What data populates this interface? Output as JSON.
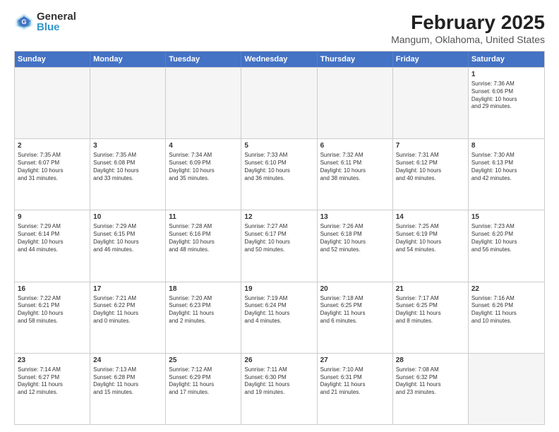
{
  "logo": {
    "general": "General",
    "blue": "Blue"
  },
  "title": "February 2025",
  "subtitle": "Mangum, Oklahoma, United States",
  "header": {
    "days": [
      "Sunday",
      "Monday",
      "Tuesday",
      "Wednesday",
      "Thursday",
      "Friday",
      "Saturday"
    ]
  },
  "rows": [
    [
      {
        "day": "",
        "empty": true
      },
      {
        "day": "",
        "empty": true
      },
      {
        "day": "",
        "empty": true
      },
      {
        "day": "",
        "empty": true
      },
      {
        "day": "",
        "empty": true
      },
      {
        "day": "",
        "empty": true
      },
      {
        "day": "1",
        "info": "Sunrise: 7:36 AM\nSunset: 6:06 PM\nDaylight: 10 hours\nand 29 minutes."
      }
    ],
    [
      {
        "day": "2",
        "info": "Sunrise: 7:35 AM\nSunset: 6:07 PM\nDaylight: 10 hours\nand 31 minutes."
      },
      {
        "day": "3",
        "info": "Sunrise: 7:35 AM\nSunset: 6:08 PM\nDaylight: 10 hours\nand 33 minutes."
      },
      {
        "day": "4",
        "info": "Sunrise: 7:34 AM\nSunset: 6:09 PM\nDaylight: 10 hours\nand 35 minutes."
      },
      {
        "day": "5",
        "info": "Sunrise: 7:33 AM\nSunset: 6:10 PM\nDaylight: 10 hours\nand 36 minutes."
      },
      {
        "day": "6",
        "info": "Sunrise: 7:32 AM\nSunset: 6:11 PM\nDaylight: 10 hours\nand 38 minutes."
      },
      {
        "day": "7",
        "info": "Sunrise: 7:31 AM\nSunset: 6:12 PM\nDaylight: 10 hours\nand 40 minutes."
      },
      {
        "day": "8",
        "info": "Sunrise: 7:30 AM\nSunset: 6:13 PM\nDaylight: 10 hours\nand 42 minutes."
      }
    ],
    [
      {
        "day": "9",
        "info": "Sunrise: 7:29 AM\nSunset: 6:14 PM\nDaylight: 10 hours\nand 44 minutes."
      },
      {
        "day": "10",
        "info": "Sunrise: 7:29 AM\nSunset: 6:15 PM\nDaylight: 10 hours\nand 46 minutes."
      },
      {
        "day": "11",
        "info": "Sunrise: 7:28 AM\nSunset: 6:16 PM\nDaylight: 10 hours\nand 48 minutes."
      },
      {
        "day": "12",
        "info": "Sunrise: 7:27 AM\nSunset: 6:17 PM\nDaylight: 10 hours\nand 50 minutes."
      },
      {
        "day": "13",
        "info": "Sunrise: 7:26 AM\nSunset: 6:18 PM\nDaylight: 10 hours\nand 52 minutes."
      },
      {
        "day": "14",
        "info": "Sunrise: 7:25 AM\nSunset: 6:19 PM\nDaylight: 10 hours\nand 54 minutes."
      },
      {
        "day": "15",
        "info": "Sunrise: 7:23 AM\nSunset: 6:20 PM\nDaylight: 10 hours\nand 56 minutes."
      }
    ],
    [
      {
        "day": "16",
        "info": "Sunrise: 7:22 AM\nSunset: 6:21 PM\nDaylight: 10 hours\nand 58 minutes."
      },
      {
        "day": "17",
        "info": "Sunrise: 7:21 AM\nSunset: 6:22 PM\nDaylight: 11 hours\nand 0 minutes."
      },
      {
        "day": "18",
        "info": "Sunrise: 7:20 AM\nSunset: 6:23 PM\nDaylight: 11 hours\nand 2 minutes."
      },
      {
        "day": "19",
        "info": "Sunrise: 7:19 AM\nSunset: 6:24 PM\nDaylight: 11 hours\nand 4 minutes."
      },
      {
        "day": "20",
        "info": "Sunrise: 7:18 AM\nSunset: 6:25 PM\nDaylight: 11 hours\nand 6 minutes."
      },
      {
        "day": "21",
        "info": "Sunrise: 7:17 AM\nSunset: 6:25 PM\nDaylight: 11 hours\nand 8 minutes."
      },
      {
        "day": "22",
        "info": "Sunrise: 7:16 AM\nSunset: 6:26 PM\nDaylight: 11 hours\nand 10 minutes."
      }
    ],
    [
      {
        "day": "23",
        "info": "Sunrise: 7:14 AM\nSunset: 6:27 PM\nDaylight: 11 hours\nand 12 minutes."
      },
      {
        "day": "24",
        "info": "Sunrise: 7:13 AM\nSunset: 6:28 PM\nDaylight: 11 hours\nand 15 minutes."
      },
      {
        "day": "25",
        "info": "Sunrise: 7:12 AM\nSunset: 6:29 PM\nDaylight: 11 hours\nand 17 minutes."
      },
      {
        "day": "26",
        "info": "Sunrise: 7:11 AM\nSunset: 6:30 PM\nDaylight: 11 hours\nand 19 minutes."
      },
      {
        "day": "27",
        "info": "Sunrise: 7:10 AM\nSunset: 6:31 PM\nDaylight: 11 hours\nand 21 minutes."
      },
      {
        "day": "28",
        "info": "Sunrise: 7:08 AM\nSunset: 6:32 PM\nDaylight: 11 hours\nand 23 minutes."
      },
      {
        "day": "",
        "empty": true
      }
    ]
  ]
}
